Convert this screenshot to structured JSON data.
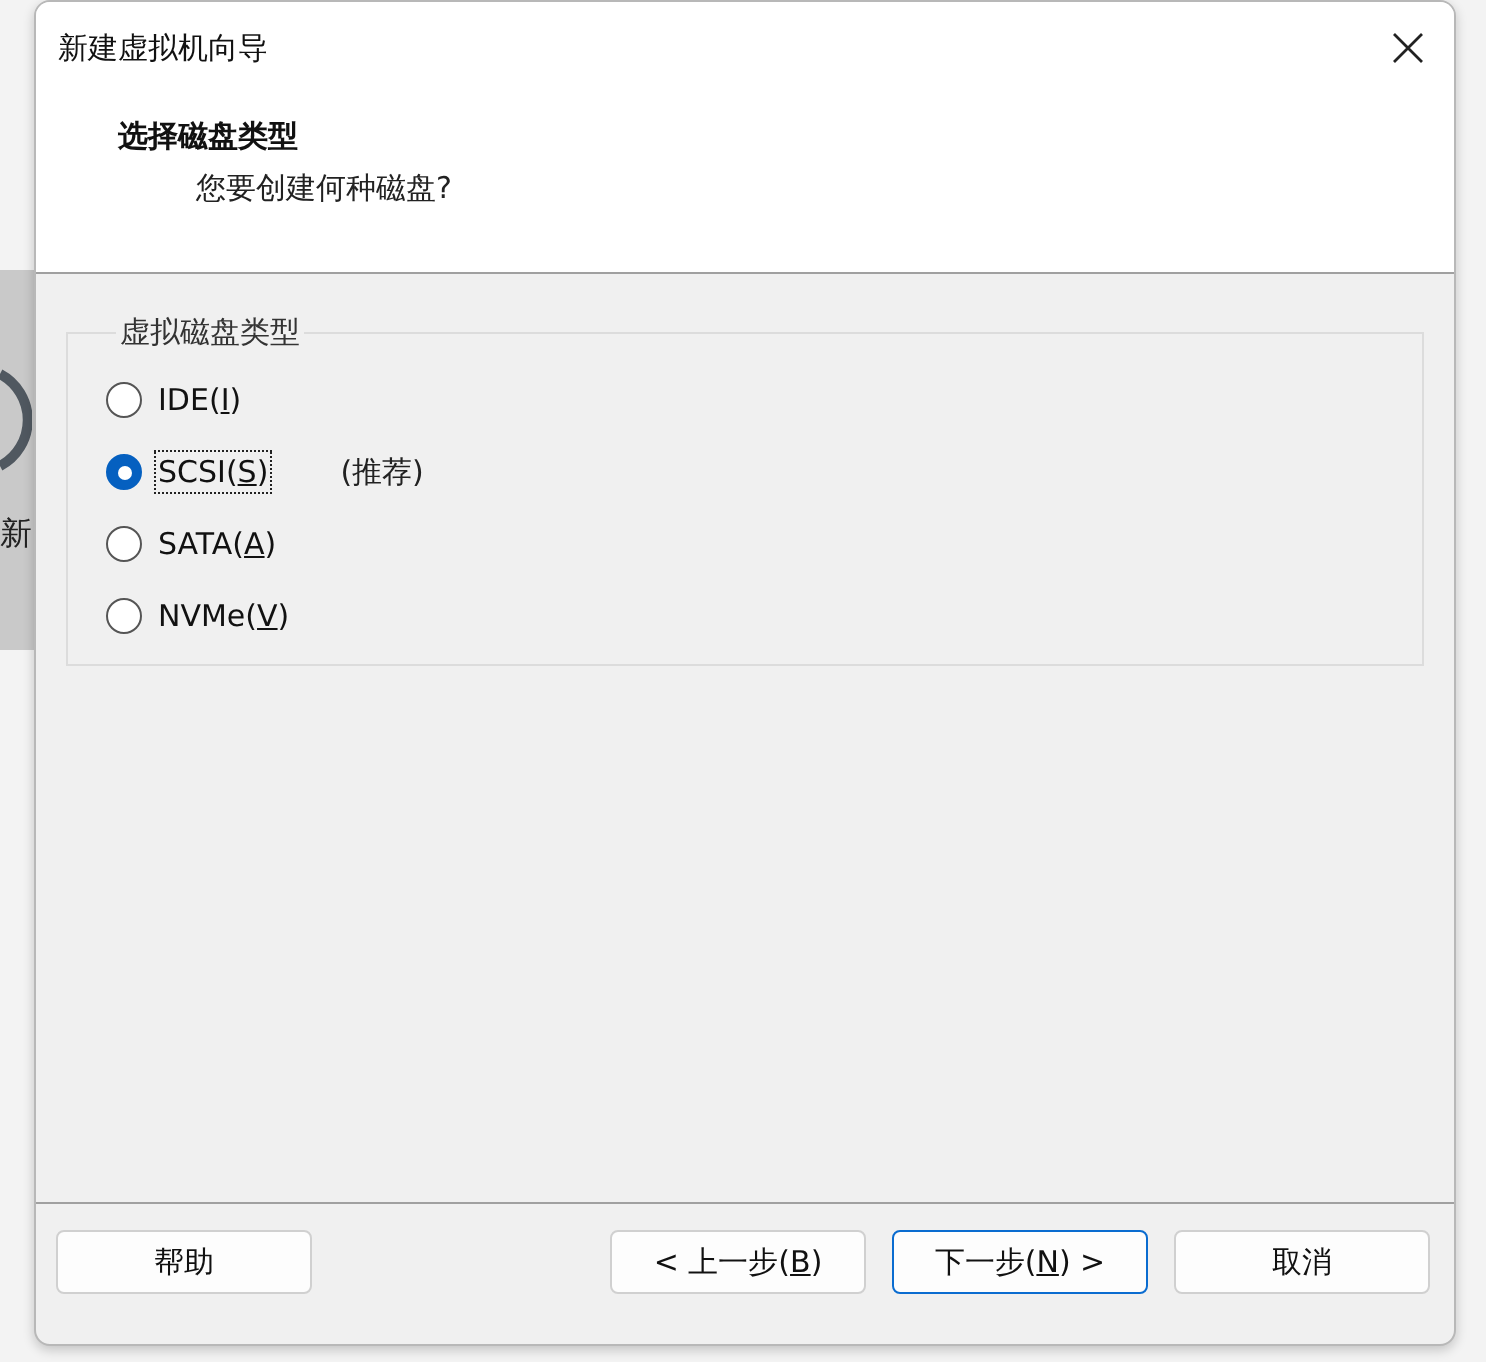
{
  "background_window": {
    "label": "新"
  },
  "window": {
    "title": "新建虚拟机向导"
  },
  "header": {
    "title": "选择磁盘类型",
    "subtitle": "您要创建何种磁盘?"
  },
  "group": {
    "legend": "虚拟磁盘类型",
    "options": [
      {
        "label_pre": "IDE(",
        "access_key": "I",
        "label_post": ")",
        "selected": false,
        "focused": false
      },
      {
        "label_pre": "SCSI(",
        "access_key": "S",
        "label_post": ")",
        "selected": true,
        "focused": true,
        "note": "(推荐)"
      },
      {
        "label_pre": "SATA(",
        "access_key": "A",
        "label_post": ")",
        "selected": false,
        "focused": false
      },
      {
        "label_pre": "NVMe(",
        "access_key": "V",
        "label_post": ")",
        "selected": false,
        "focused": false
      }
    ]
  },
  "buttons": [
    {
      "label_pre": "帮助",
      "default": false
    },
    {
      "label_pre": "< 上一步(",
      "access_key": "B",
      "label_post": ")",
      "default": false
    },
    {
      "label_pre": "下一步(",
      "access_key": "N",
      "label_post": ") >",
      "default": true
    },
    {
      "label_pre": "取消",
      "default": false
    }
  ]
}
